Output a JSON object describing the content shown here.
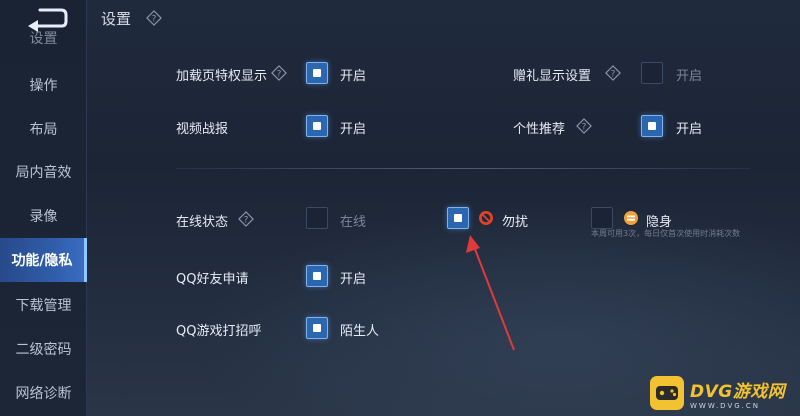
{
  "header": {
    "title": "设置"
  },
  "sidebar": {
    "items": [
      {
        "label": "设置"
      },
      {
        "label": "操作"
      },
      {
        "label": "布局"
      },
      {
        "label": "局内音效"
      },
      {
        "label": "录像"
      },
      {
        "label": "功能/隐私"
      },
      {
        "label": "下载管理"
      },
      {
        "label": "二级密码"
      },
      {
        "label": "网络诊断"
      }
    ]
  },
  "settings": {
    "loading_privilege": {
      "label": "加载页特权显示",
      "checked": true,
      "value": "开启"
    },
    "gift_display": {
      "label": "赠礼显示设置",
      "checked": false,
      "value": "开启"
    },
    "video_report": {
      "label": "视频战报",
      "checked": true,
      "value": "开启"
    },
    "personal_recommend": {
      "label": "个性推荐",
      "checked": true,
      "value": "开启"
    },
    "online_status": {
      "label": "在线状态",
      "options": [
        {
          "label": "在线",
          "checked": false
        },
        {
          "label": "勿扰",
          "checked": true
        },
        {
          "label": "隐身",
          "checked": false
        }
      ],
      "note": "本周可用3次，每日仅首次使用时消耗次数"
    },
    "qq_friend_request": {
      "label": "QQ好友申请",
      "checked": true,
      "value": "开启"
    },
    "qq_game_greeting": {
      "label": "QQ游戏打招呼",
      "checked": true,
      "value": "陌生人"
    }
  },
  "watermark": {
    "main": "DVG游戏网",
    "sub": "WWW.DVG.CN"
  },
  "colors": {
    "accent": "#2b66b0",
    "active_tab": "#2f5ca8",
    "dnd_icon": "#e0412b",
    "invisible_icon": "#f0a23a",
    "arrow": "#e03a3a",
    "watermark": "#f2c230"
  }
}
